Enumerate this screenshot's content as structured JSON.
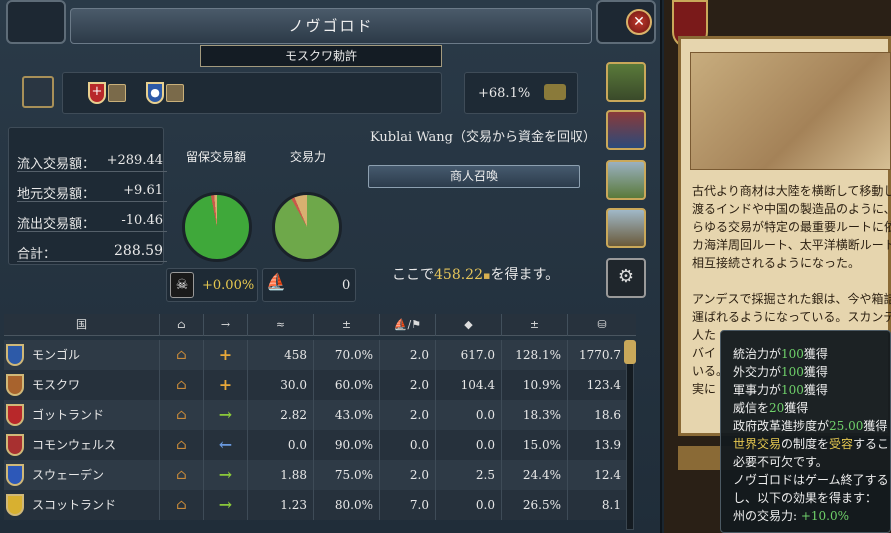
{
  "header": {
    "title": "ノヴゴロド",
    "subtitle": "モスクワ勅許",
    "close_glyph": "✕"
  },
  "trade_power_percent": "+68.1%",
  "stats": [
    {
      "label": "流入交易額：",
      "value": "+289.44"
    },
    {
      "label": "地元交易額：",
      "value": "+9.61"
    },
    {
      "label": "流出交易額：",
      "value": "-10.46"
    },
    {
      "label": "合計：",
      "value": "288.59"
    }
  ],
  "pies": {
    "retained_label": "留保交易額",
    "power_label": "交易力",
    "retained_fraction": 0.97,
    "power_fraction": 0.92
  },
  "pirates": {
    "value": "+0.00%",
    "ships": "0"
  },
  "merchant": {
    "name_line": "Kublai Wang（交易から資金を回収）",
    "button": "商人召喚",
    "gain_prefix": "ここで",
    "gain_value": "458.22",
    "gain_suffix": "を得ます。"
  },
  "table": {
    "headers": [
      "国",
      "⌂",
      "→",
      "≈",
      "±",
      "⛵/⚑",
      "◆",
      "±",
      "⛁"
    ],
    "rows": [
      {
        "country": "モンゴル",
        "flag_color": "#2d5aa8",
        "action": "+",
        "c3": "458",
        "c4": "70.0%",
        "c5": "2.0",
        "c6": "617.0",
        "c7": "128.1%",
        "c8": "1770.7"
      },
      {
        "country": "モスクワ",
        "flag_color": "#a8632d",
        "action": "+",
        "c3": "30.0",
        "c4": "60.0%",
        "c5": "2.0",
        "c6": "104.4",
        "c7": "10.9%",
        "c8": "123.4"
      },
      {
        "country": "ゴットランド",
        "flag_color": "#b8282a",
        "action": "→",
        "c3": "2.82",
        "c4": "43.0%",
        "c5": "2.0",
        "c6": "0.0",
        "c7": "18.3%",
        "c8": "18.6"
      },
      {
        "country": "コモンウェルス",
        "flag_color": "#a83030",
        "action": "←",
        "c3": "0.0",
        "c4": "90.0%",
        "c5": "0.0",
        "c6": "0.0",
        "c7": "15.0%",
        "c8": "13.9"
      },
      {
        "country": "スウェーデン",
        "flag_color": "#2d58b8",
        "action": "→",
        "c3": "1.88",
        "c4": "75.0%",
        "c5": "2.0",
        "c6": "2.5",
        "c7": "24.4%",
        "c8": "12.4"
      },
      {
        "country": "スコットランド",
        "flag_color": "#d8b030",
        "action": "→",
        "c3": "1.23",
        "c4": "80.0%",
        "c5": "7.0",
        "c6": "0.0",
        "c7": "26.5%",
        "c8": "8.1"
      }
    ]
  },
  "flavor": {
    "lines1": [
      "古代より商材は大陸を横断して移動し",
      "渡るインドや中国の製造品のように、",
      "らゆる交易が特定の最重要ルートに依",
      "カ海洋周回ルート、太平洋横断ルート",
      "相互接続されるようになった。"
    ],
    "lines2": [
      "アンデスで採掘された銀は、今や箱詰",
      "運ばれるようになっている。スカンデ",
      "人た",
      "バイ",
      "いる。",
      "実に"
    ]
  },
  "tooltip": {
    "l1_pre": "統治力が",
    "l1_val": "100",
    "l1_post": "獲得",
    "l2_pre": "外交力が",
    "l2_val": "100",
    "l2_post": "獲得",
    "l3_pre": "軍事力が",
    "l3_val": "100",
    "l3_post": "獲得",
    "l4_pre": "威信を",
    "l4_val": "20",
    "l4_post": "獲得",
    "l5_pre": "政府改革進捗度が",
    "l5_val": "25.00",
    "l5_post": "獲得",
    "l6_a": "世界交易",
    "l6_b": "の制度を",
    "l6_c": "受容",
    "l6_d": "するこ",
    "l7": "必要不可欠です。",
    "l8": "ノヴゴロドはゲーム終了する",
    "l9": "し、以下の効果を得ます：",
    "l10_pre": "州の交易力: ",
    "l10_val": "+10.0%"
  },
  "colors": {
    "accent_gold": "#c9a85a",
    "positive": "#6fd16a",
    "pie_green": "#3fa83a"
  }
}
